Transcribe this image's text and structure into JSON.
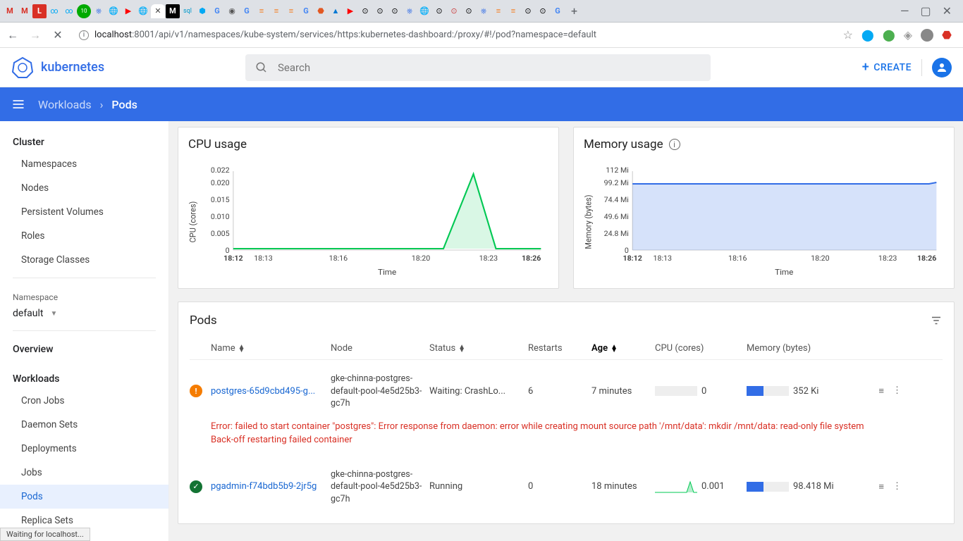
{
  "browser": {
    "url_prefix": "localhost",
    "url_rest": ":8001/api/v1/namespaces/kube-system/services/https:kubernetes-dashboard:/proxy/#!/pod?namespace=default",
    "status": "Waiting for localhost..."
  },
  "header": {
    "logo_text": "kubernetes",
    "search_placeholder": "Search",
    "create_label": "CREATE"
  },
  "breadcrumb": {
    "parent": "Workloads",
    "current": "Pods"
  },
  "sidebar": {
    "cluster_label": "Cluster",
    "cluster_items": [
      "Namespaces",
      "Nodes",
      "Persistent Volumes",
      "Roles",
      "Storage Classes"
    ],
    "namespace_label": "Namespace",
    "namespace_value": "default",
    "overview_label": "Overview",
    "workloads_label": "Workloads",
    "workloads_items": [
      "Cron Jobs",
      "Daemon Sets",
      "Deployments",
      "Jobs",
      "Pods",
      "Replica Sets"
    ],
    "active": "Pods"
  },
  "charts": {
    "cpu": {
      "title": "CPU usage",
      "ylabel": "CPU (cores)",
      "xlabel": "Time"
    },
    "mem": {
      "title": "Memory usage",
      "ylabel": "Memory (bytes)",
      "xlabel": "Time"
    }
  },
  "chart_data": [
    {
      "type": "area",
      "title": "CPU usage",
      "xlabel": "Time",
      "ylabel": "CPU (cores)",
      "ylim": [
        0,
        0.022
      ],
      "x_ticks": [
        "18:12",
        "18:13",
        "18:16",
        "18:20",
        "18:23",
        "18:26"
      ],
      "y_ticks": [
        0,
        0.005,
        0.01,
        0.015,
        0.02,
        0.022
      ],
      "series": [
        {
          "name": "cpu",
          "color": "#00c853",
          "x": [
            "18:12",
            "18:13",
            "18:14",
            "18:15",
            "18:16",
            "18:17",
            "18:18",
            "18:19",
            "18:20",
            "18:21",
            "18:22",
            "18:23",
            "18:24",
            "18:25",
            "18:26"
          ],
          "values": [
            0.001,
            0.001,
            0.001,
            0.001,
            0.001,
            0.001,
            0.001,
            0.001,
            0.001,
            0.001,
            0.001,
            0.02,
            0.001,
            0.001,
            0.001
          ]
        }
      ]
    },
    {
      "type": "area",
      "title": "Memory usage",
      "xlabel": "Time",
      "ylabel": "Memory (bytes)",
      "ylim": [
        0,
        112
      ],
      "y_unit": "Mi",
      "x_ticks": [
        "18:12",
        "18:13",
        "18:16",
        "18:20",
        "18:23",
        "18:26"
      ],
      "y_ticks": [
        0,
        24.8,
        49.6,
        74.4,
        99.2,
        112
      ],
      "series": [
        {
          "name": "memory",
          "color": "#326de6",
          "x": [
            "18:12",
            "18:13",
            "18:14",
            "18:15",
            "18:16",
            "18:17",
            "18:18",
            "18:19",
            "18:20",
            "18:21",
            "18:22",
            "18:23",
            "18:24",
            "18:25",
            "18:26"
          ],
          "values": [
            99,
            99,
            99,
            99,
            99,
            99,
            99,
            99,
            99,
            99,
            99,
            99,
            99,
            99,
            100
          ]
        }
      ]
    }
  ],
  "pods": {
    "title": "Pods",
    "columns": {
      "name": "Name",
      "node": "Node",
      "status": "Status",
      "restarts": "Restarts",
      "age": "Age",
      "cpu": "CPU (cores)",
      "memory": "Memory (bytes)"
    },
    "rows": [
      {
        "status": "warn",
        "name": "postgres-65d9cbd495-g...",
        "node": "gke-chinna-postgres-default-pool-4e5d25b3-gc7h",
        "status_text": "Waiting: CrashLo...",
        "restarts": "6",
        "age": "7 minutes",
        "cpu": "0",
        "memory": "352 Ki",
        "mem_bar_pct": 40,
        "error": "Error: failed to start container \"postgres\": Error response from daemon: error while creating mount source path '/mnt/data': mkdir /mnt/data: read-only file system\nBack-off restarting failed container"
      },
      {
        "status": "ok",
        "name": "pgadmin-f74bdb5b9-2jr5g",
        "node": "gke-chinna-postgres-default-pool-4e5d25b3-gc7h",
        "status_text": "Running",
        "restarts": "0",
        "age": "18 minutes",
        "cpu": "0.001",
        "memory": "98.418 Mi",
        "mem_bar_pct": 40
      }
    ]
  }
}
